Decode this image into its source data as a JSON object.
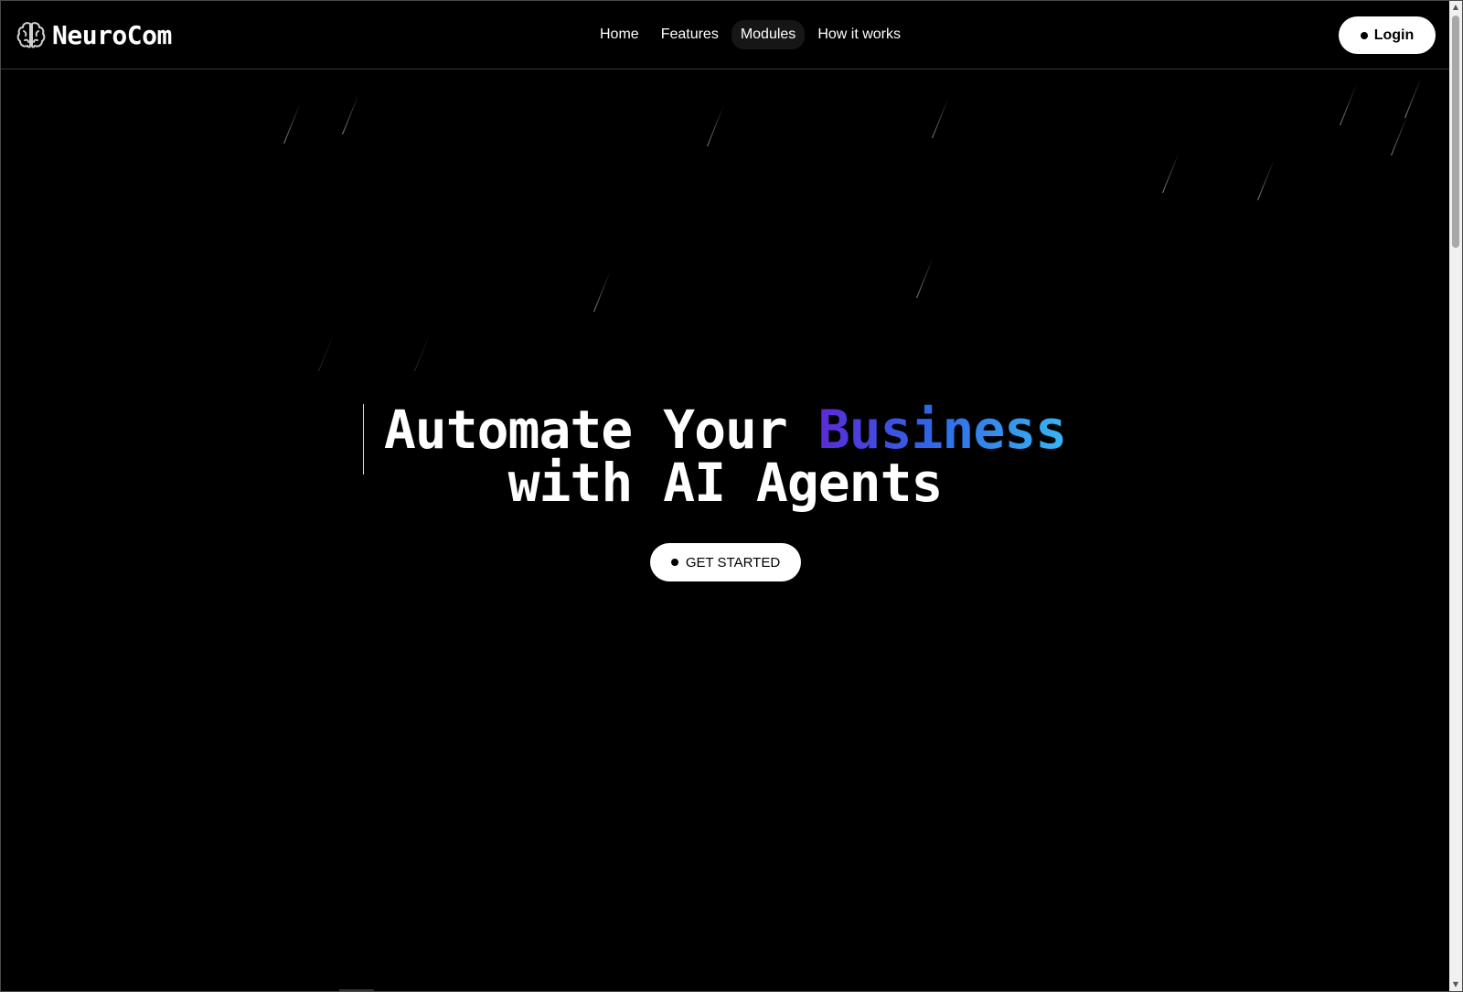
{
  "nav": {
    "brand": "NeuroCom",
    "links": [
      {
        "label": "Home"
      },
      {
        "label": "Features"
      },
      {
        "label": "Modules",
        "active": true
      },
      {
        "label": "How it works"
      }
    ],
    "login_label": "Login"
  },
  "hero": {
    "headline_part1": "Automate Your ",
    "headline_accent": "Business",
    "headline_part2": "with AI Agents",
    "cta_label": "GET STARTED"
  },
  "colors": {
    "background": "#000000",
    "accent_gradient": [
      "#5b2ad6",
      "#2f66e6",
      "#39b6f2"
    ]
  },
  "icons": {
    "brand": "brain-icon",
    "button_bullet": "dot-icon",
    "scroll_up": "scroll-up-arrow-icon",
    "scroll_down": "scroll-down-arrow-icon"
  }
}
